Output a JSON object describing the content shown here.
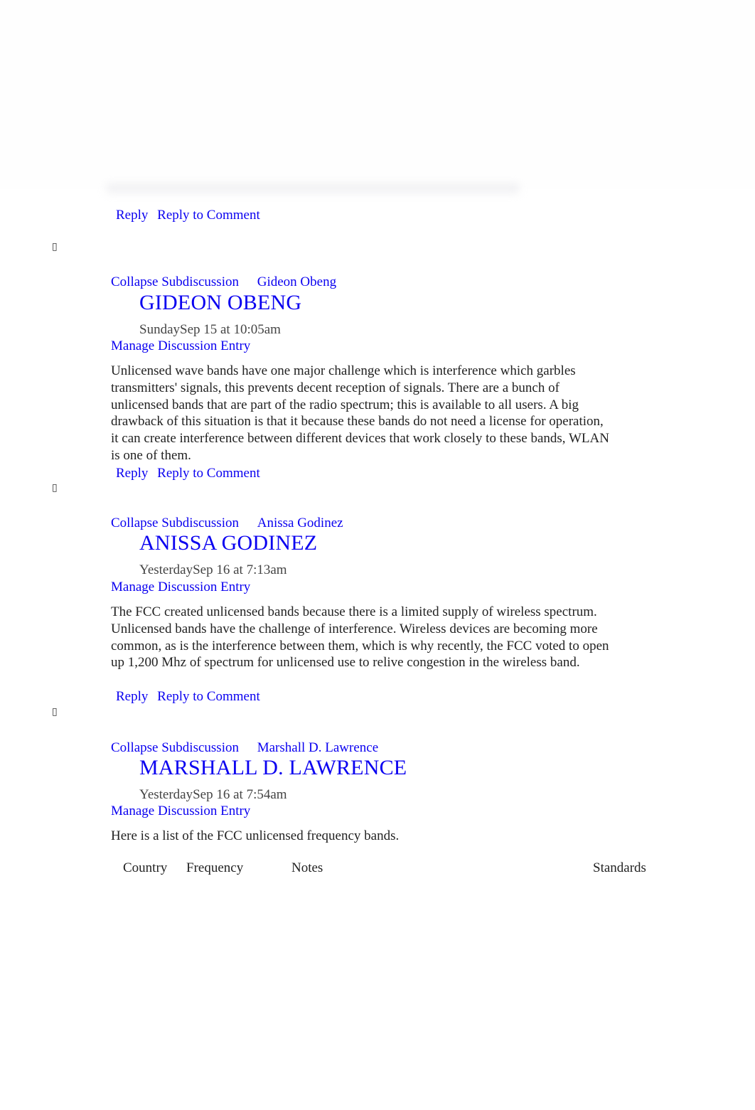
{
  "first_entry_actions": {
    "reply": "Reply",
    "reply_to_comment": "Reply to Comment"
  },
  "entries": [
    {
      "marker_icon": "missing-glyph-icon",
      "collapse_label": "Collapse Subdiscussion",
      "author_link": "Gideon Obeng",
      "author_heading": "GIDEON OBENG",
      "date": "SundaySep 15 at 10:05am",
      "manage_label": "Manage Discussion Entry",
      "body": "Unlicensed wave bands have one major challenge which is interference which garbles transmitters' signals, this prevents decent reception of signals. There are a bunch of unlicensed bands that are part of the radio spectrum; this is available to all users. A big drawback of this situation is that it because these bands do not need a license for operation, it can create interference between different devices that work closely to these bands, WLAN is one of them.",
      "reply": "Reply",
      "reply_to_comment": "Reply to Comment"
    },
    {
      "marker_icon": "missing-glyph-icon",
      "collapse_label": "Collapse Subdiscussion",
      "author_link": "Anissa Godinez",
      "author_heading": "ANISSA GODINEZ",
      "date": "YesterdaySep 16 at 7:13am",
      "manage_label": "Manage Discussion Entry",
      "body": "The FCC created unlicensed bands because there is a limited supply of wireless spectrum. Unlicensed bands have the challenge of interference. Wireless devices are becoming more common, as is the interference between them, which is why recently, the FCC voted to open up 1,200 Mhz of spectrum for unlicensed use to relive congestion in the wireless band.",
      "reply": "Reply",
      "reply_to_comment": "Reply to Comment"
    },
    {
      "marker_icon": "missing-glyph-icon",
      "collapse_label": "Collapse Subdiscussion",
      "author_link": "Marshall D. Lawrence",
      "author_heading": "MARSHALL D. LAWRENCE",
      "date": "YesterdaySep 16 at 7:54am",
      "manage_label": "Manage Discussion Entry",
      "body": "Here is a list of the FCC unlicensed frequency bands.",
      "table_headers": [
        "Country",
        "Frequency",
        "Notes",
        "Standards"
      ]
    }
  ],
  "colors": {
    "link": "#0a00f0",
    "text": "#222222",
    "date": "#444444",
    "background": "#ffffff"
  }
}
